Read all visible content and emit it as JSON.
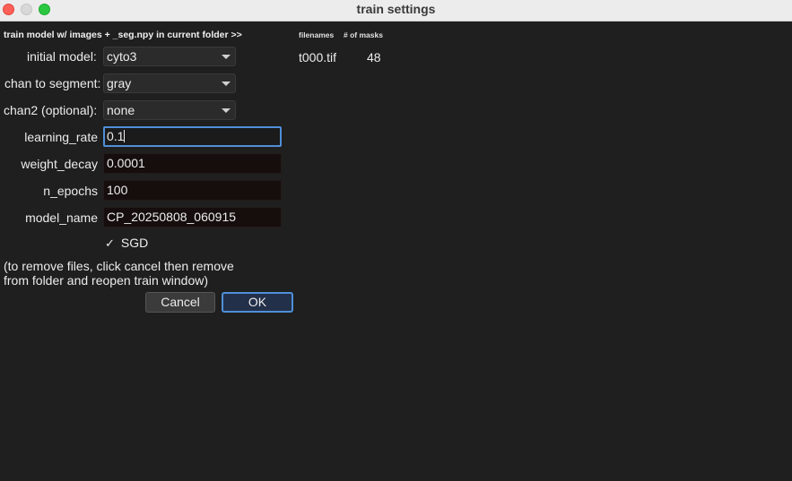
{
  "window": {
    "title": "train settings"
  },
  "header": {
    "instruction": "train model w/ images + _seg.npy in current folder >>",
    "filenames_label": "filenames",
    "masks_label": "# of masks"
  },
  "form": {
    "initial_model": {
      "label": "initial model:",
      "value": "cyto3"
    },
    "chan_to_segment": {
      "label": "chan to segment:",
      "value": "gray"
    },
    "chan2": {
      "label": "chan2 (optional):",
      "value": "none"
    },
    "learning_rate": {
      "label": "learning_rate",
      "value": "0.1"
    },
    "weight_decay": {
      "label": "weight_decay",
      "value": "0.0001"
    },
    "n_epochs": {
      "label": "n_epochs",
      "value": "100"
    },
    "model_name": {
      "label": "model_name",
      "value": "CP_20250808_060915"
    },
    "sgd": {
      "label": "SGD",
      "check": "✓",
      "checked": true
    }
  },
  "note": {
    "line1": "(to remove files, click cancel then remove",
    "line2": "from folder and reopen train window)"
  },
  "buttons": {
    "cancel": "Cancel",
    "ok": "OK"
  },
  "files": [
    {
      "filename": "t000.tif",
      "masks": "48"
    }
  ],
  "colors": {
    "accent": "#4f8fd8",
    "background": "#1f1f1f",
    "field_bg": "#150e0d"
  }
}
